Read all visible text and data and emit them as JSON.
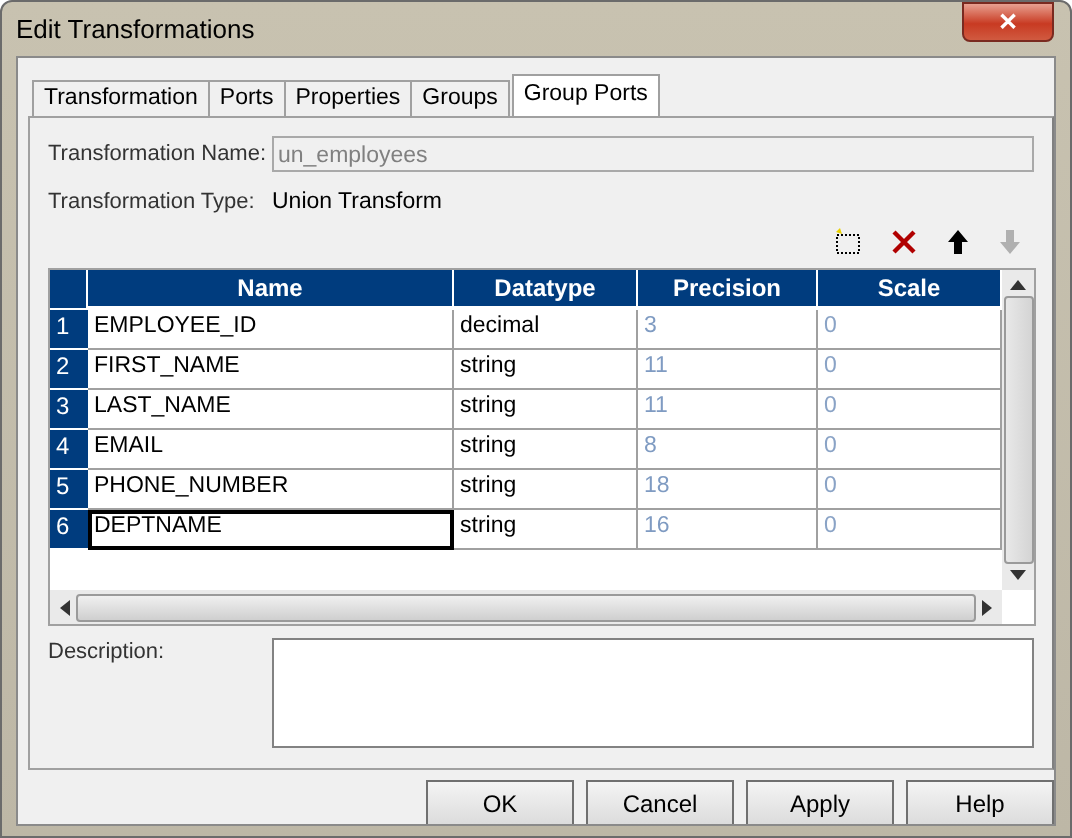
{
  "window": {
    "title": "Edit Transformations",
    "close": "✕"
  },
  "tabs": [
    {
      "label": "Transformation",
      "selected": false
    },
    {
      "label": "Ports",
      "selected": false
    },
    {
      "label": "Properties",
      "selected": false
    },
    {
      "label": "Groups",
      "selected": false
    },
    {
      "label": "Group Ports",
      "selected": true
    }
  ],
  "transformation_name": {
    "label": "Transformation Name:",
    "value": "un_employees",
    "disabled": true
  },
  "transformation_type": {
    "label": "Transformation Type:",
    "value": "Union Transform"
  },
  "toolbar": [
    {
      "kind": "new",
      "disabled": false
    },
    {
      "kind": "delete",
      "disabled": false
    },
    {
      "kind": "up",
      "disabled": false
    },
    {
      "kind": "down",
      "disabled": true
    }
  ],
  "table": {
    "columns": [
      "Name",
      "Datatype",
      "Precision",
      "Scale"
    ],
    "rows": [
      {
        "index": "1",
        "name": "EMPLOYEE_ID",
        "datatype": "decimal",
        "precision": "3",
        "scale": "0",
        "selected": false
      },
      {
        "index": "2",
        "name": "FIRST_NAME",
        "datatype": "string",
        "precision": "11",
        "scale": "0",
        "selected": false
      },
      {
        "index": "3",
        "name": "LAST_NAME",
        "datatype": "string",
        "precision": "11",
        "scale": "0",
        "selected": false
      },
      {
        "index": "4",
        "name": "EMAIL",
        "datatype": "string",
        "precision": "8",
        "scale": "0",
        "selected": false
      },
      {
        "index": "5",
        "name": "PHONE_NUMBER",
        "datatype": "string",
        "precision": "18",
        "scale": "0",
        "selected": false
      },
      {
        "index": "6",
        "name": "DEPTNAME",
        "datatype": "string",
        "precision": "16",
        "scale": "0",
        "selected": true
      }
    ]
  },
  "description": {
    "label": "Description:"
  },
  "buttons": [
    "OK",
    "Cancel",
    "Apply",
    "Help"
  ]
}
